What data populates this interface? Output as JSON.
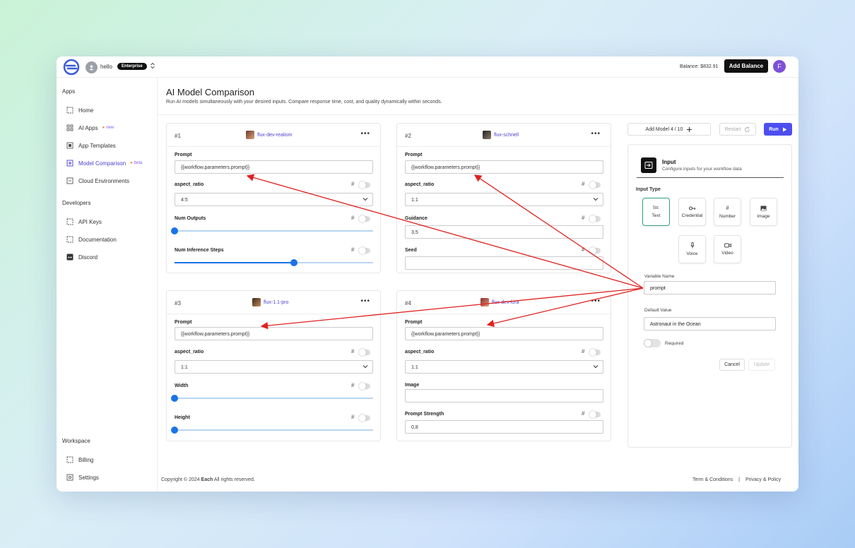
{
  "topbar": {
    "org_name": "hello",
    "plan_badge": "Enterprise",
    "balance": "Balance: $832.91",
    "add_balance": "Add Balance",
    "user_initial": "F"
  },
  "sidebar": {
    "apps_title": "Apps",
    "apps": [
      {
        "label": "Home"
      },
      {
        "label": "AI Apps",
        "tag": "new"
      },
      {
        "label": "App Templates"
      },
      {
        "label": "Model Comparison",
        "tag": "beta"
      },
      {
        "label": "Cloud Environments"
      }
    ],
    "dev_title": "Developers",
    "developers": [
      {
        "label": "API Keys"
      },
      {
        "label": "Documentation"
      },
      {
        "label": "Discord"
      }
    ],
    "ws_title": "Workspace",
    "workspace": [
      {
        "label": "Billing"
      },
      {
        "label": "Settings"
      }
    ]
  },
  "header": {
    "title": "AI Model Comparison",
    "subtitle": "Run AI models simultaneously with your desired inputs. Compare response time, cost, and quality dynamically within seconds."
  },
  "cards": [
    {
      "num": "#1",
      "model": "flux-dev-realism",
      "fields": [
        "Prompt",
        "aspect_ratio",
        "Num Outputs",
        "Num Inference Steps"
      ],
      "prompt": "{{workflow.parameters.prompt}}",
      "aspect": "4:5",
      "slider1": 0.0,
      "slider2": 0.6
    },
    {
      "num": "#2",
      "model": "flux-schnell",
      "fields": [
        "Prompt",
        "aspect_ratio",
        "Guidance",
        "Seed"
      ],
      "prompt": "{{workflow.parameters.prompt}}",
      "aspect": "1:1",
      "guidance": "3,5"
    },
    {
      "num": "#3",
      "model": "flux-1.1-pro",
      "fields": [
        "Prompt",
        "aspect_ratio",
        "Width",
        "Height"
      ],
      "prompt": "{{workflow.parameters.prompt}}",
      "aspect": "1:1",
      "slider1": 0.0,
      "slider2": 0.0
    },
    {
      "num": "#4",
      "model": "flux-dev-lora",
      "fields": [
        "Prompt",
        "aspect_ratio",
        "Image",
        "Prompt Strength"
      ],
      "prompt": "{{workflow.parameters.prompt}}",
      "aspect": "1:1",
      "strength": "0,8"
    }
  ],
  "hash_symbol": "#",
  "actions": {
    "add_model": "Add Model 4 / 10",
    "restart": "Restart",
    "run": "Run"
  },
  "input_panel": {
    "title": "Input",
    "subtitle": "Configure inputs for your workflow data",
    "type_label": "Input Type",
    "types": [
      "Text",
      "Credential",
      "Number",
      "Image",
      "Voice",
      "Video"
    ],
    "text_glyph": "Str.",
    "var_label": "Variable Name",
    "var_value": "prompt",
    "default_label": "Default Value",
    "default_value": "Astronaut in the Ocean",
    "required": "Required",
    "cancel": "Cancel",
    "update": "Update"
  },
  "footer": {
    "copyright_prefix": "Copyright © 2024 ",
    "brand": "Each",
    "copyright_suffix": " All rights reserved.",
    "terms": "Term & Conditions",
    "divider": "|",
    "privacy": "Privacy & Policy"
  },
  "colors": {
    "accent": "#4b3fd1",
    "run": "#4d4ef0",
    "slider": "#1a73e8",
    "arrow": "#e02020"
  }
}
